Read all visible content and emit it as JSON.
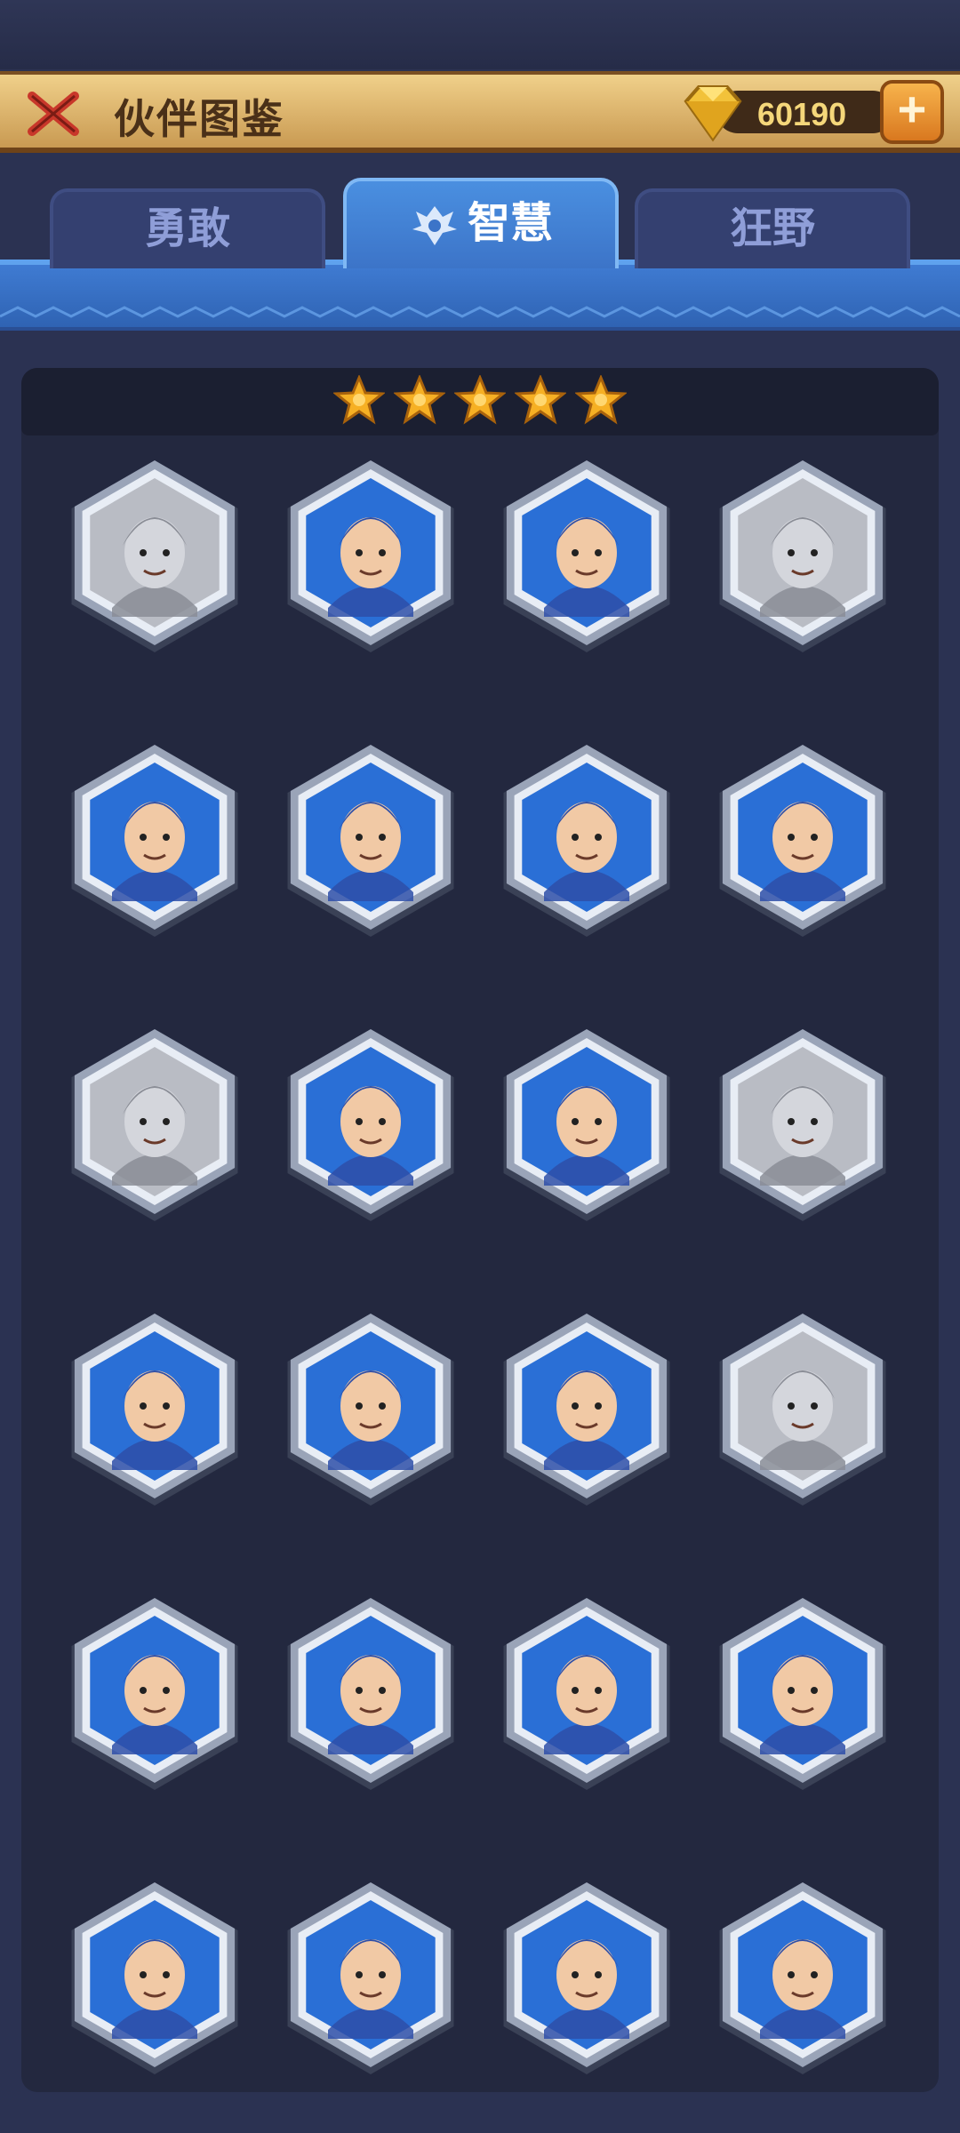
{
  "header": {
    "title": "伙伴图鉴",
    "gems": "60190",
    "plus_label": "+"
  },
  "tabs": [
    {
      "label": "勇敢",
      "active": false
    },
    {
      "label": "智慧",
      "active": true
    },
    {
      "label": "狂野",
      "active": false
    }
  ],
  "star_rating": 5,
  "heroes": [
    {
      "id": "werewolf",
      "icon": "werewolf-portrait-icon",
      "locked": true
    },
    {
      "id": "skull-girl",
      "icon": "skull-girl-portrait-icon",
      "locked": false
    },
    {
      "id": "dragon",
      "icon": "dragon-portrait-icon",
      "locked": false
    },
    {
      "id": "old-sage",
      "icon": "old-sage-portrait-icon",
      "locked": true
    },
    {
      "id": "elf-prince",
      "icon": "elf-prince-portrait-icon",
      "locked": false
    },
    {
      "id": "hooded-woman",
      "icon": "hooded-woman-portrait-icon",
      "locked": false
    },
    {
      "id": "sea-princess",
      "icon": "sea-princess-portrait-icon",
      "locked": false
    },
    {
      "id": "monkey-king",
      "icon": "monkey-king-portrait-icon",
      "locked": false
    },
    {
      "id": "tiger",
      "icon": "tiger-portrait-icon",
      "locked": true
    },
    {
      "id": "scarecrow",
      "icon": "scarecrow-portrait-icon",
      "locked": false
    },
    {
      "id": "warrior",
      "icon": "warrior-portrait-icon",
      "locked": false
    },
    {
      "id": "knight-girl",
      "icon": "knight-girl-portrait-icon",
      "locked": true
    },
    {
      "id": "elf-woman",
      "icon": "elf-woman-portrait-icon",
      "locked": false
    },
    {
      "id": "skull-helmet-kid",
      "icon": "skull-helmet-kid-portrait-icon",
      "locked": false
    },
    {
      "id": "vampire",
      "icon": "vampire-portrait-icon",
      "locked": false
    },
    {
      "id": "stone-golem",
      "icon": "stone-golem-portrait-icon",
      "locked": true
    },
    {
      "id": "walrus-captain",
      "icon": "walrus-captain-portrait-icon",
      "locked": false
    },
    {
      "id": "fox-thief",
      "icon": "fox-thief-portrait-icon",
      "locked": false
    },
    {
      "id": "mammoth",
      "icon": "mammoth-portrait-icon",
      "locked": false
    },
    {
      "id": "blue-witch",
      "icon": "blue-witch-portrait-icon",
      "locked": false
    },
    {
      "id": "minotaur",
      "icon": "minotaur-portrait-icon",
      "locked": false
    },
    {
      "id": "skeleton-warrior",
      "icon": "skeleton-warrior-portrait-icon",
      "locked": false
    },
    {
      "id": "medusa",
      "icon": "medusa-portrait-icon",
      "locked": false
    },
    {
      "id": "tree-spirit",
      "icon": "tree-spirit-portrait-icon",
      "locked": false
    }
  ],
  "colors": {
    "frame_outer": "#9aa4b8",
    "frame_inner": "#e8edf5",
    "portrait_bg": "#2a6fd6",
    "locked_tint": "#b9bcc4",
    "star_gold": "#f6b024"
  }
}
